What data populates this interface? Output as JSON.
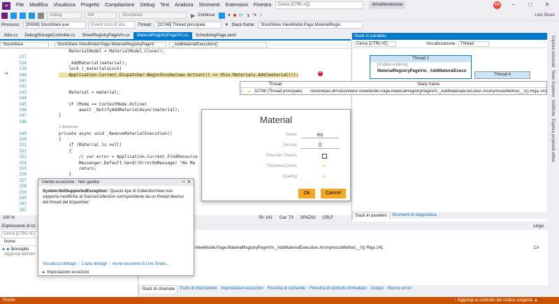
{
  "menu": {
    "items": [
      "File",
      "Modifica",
      "Visualizza",
      "Progetto",
      "Compilazione",
      "Debug",
      "Test",
      "Analizza",
      "Strumenti",
      "Estensioni",
      "Finestra",
      "?"
    ],
    "search_placeholder": "Cerca (CTRL+Q)",
    "app_name": "AlmaWarehouse",
    "avatar": "MN",
    "live_share": "Live Share"
  },
  "toolbar": {
    "config": "Debug",
    "platform": "x64",
    "project": "StockWare",
    "continue": "Continua",
    "processo_label": "Processo:",
    "processo": "[30888] StockWare.exe",
    "eventi": "Eventi ciclo di vita",
    "thread_label": "Thread:",
    "thread": "[32748] Thread principale",
    "stack_label": "Stack frame:",
    "stack": "StockWare.ViewModel.Page.MaterialRegio"
  },
  "tabs": [
    {
      "label": "Jobs.cs"
    },
    {
      "label": "DebugStorageController.cs"
    },
    {
      "label": "SheetRegistryPageVm.cs"
    },
    {
      "label": "MaterialRegistryPageVm.cs",
      "active": true
    },
    {
      "label": "SchedulingPage.xaml"
    }
  ],
  "navbar": {
    "project": "StockWare",
    "class": "StockWare.ViewModel.Page.MaterialRegistryPageV",
    "method": "_AddMaterialExecution()"
  },
  "code": {
    "lines": [
      {
        "n": "",
        "t": "    MaterialNodel = MaterialModel.Clone();"
      },
      {
        "n": "137",
        "t": ""
      },
      {
        "n": "138",
        "t": "    _AddMaterial(material);"
      },
      {
        "n": "139",
        "t": "    lock (_materialsLock)"
      },
      {
        "n": "140",
        "t": "    Application.Current.Dispatcher.BeginInvoke(new Action(() => this.Materials.Add(material)));"
      },
      {
        "n": "141",
        "t": ""
      },
      {
        "n": "142",
        "t": ""
      },
      {
        "n": "143",
        "t": "    Material = material;"
      },
      {
        "n": "144",
        "t": ""
      },
      {
        "n": "145",
        "t": "    if (Mode == ContextMode.Online)"
      },
      {
        "n": "146",
        "t": "        await _NotifyAddMaterialAsync(material);"
      },
      {
        "n": "147",
        "t": "}"
      },
      {
        "n": "148",
        "t": ""
      },
      {
        "n": "",
        "t": "1 riferimento"
      },
      {
        "n": "149",
        "t": "private async void _RemoveMaterialExecution()"
      },
      {
        "n": "150",
        "t": "{"
      },
      {
        "n": "151",
        "t": "    if (Material is null)"
      },
      {
        "n": "152",
        "t": "    {"
      },
      {
        "n": "153",
        "t": "        // var error = Application.Current.FindResource"
      },
      {
        "n": "154",
        "t": "        Messenger.Default.Send((ErrorVmMessage) \"No Ma"
      },
      {
        "n": "155",
        "t": "        return;"
      },
      {
        "n": "156",
        "t": "    }"
      },
      {
        "n": "157",
        "t": ""
      },
      {
        "n": "158",
        "t": ""
      },
      {
        "n": "159",
        "t": ""
      },
      {
        "n": "160",
        "t": ""
      },
      {
        "n": "161",
        "t": ""
      },
      {
        "n": "162",
        "t": ""
      }
    ]
  },
  "editor_status": {
    "zoom": "100 %",
    "line": "Ri: 141",
    "col": "Car: 73",
    "space": "SPAZIO",
    "eol": "CRLF"
  },
  "parallel_stack": {
    "title": "Stack in parallelo",
    "search_placeholder": "Cerca (CTRL+E)",
    "view_label": "Visualizzazione:",
    "view": "Thread",
    "thread1": "Thread 1",
    "ext": "[Codice esterno]",
    "frame": "MaterialRegistryPageVm._AddMaterialExecu",
    "thread4": "Thread 4",
    "tabs": [
      "Stack in parallelo",
      "Strumenti di diagnostica"
    ]
  },
  "tooltip": {
    "col_thread": "Thread",
    "col_frame": "Stack frame",
    "thread": "32748 (Thread principale)",
    "frame": "StockWare.dll!StockWare.ViewModel.Page.MaterialRegistryPageVm._AddMaterialExecution.AnonymousMethod__0() Riga 141"
  },
  "dialog": {
    "title": "Material",
    "fields": [
      {
        "label": "Name",
        "value": "es",
        "kind": "text"
      },
      {
        "label": "Density",
        "value": "0",
        "kind": "text"
      },
      {
        "label": "Override Checks",
        "kind": "check"
      },
      {
        "label": "ThicknessCheck",
        "kind": "lines"
      },
      {
        "label": "Spalling",
        "kind": "lines"
      }
    ],
    "ok": "Ok",
    "cancel": "Cancel",
    "accent": "#f5a623"
  },
  "exception": {
    "header": "Utente eccezione - Non gestita",
    "type": "System.NotSupportedException:",
    "message": " 'Questo tipo di CollectionView non supporta modifiche al SourceCollection corrispondente da un thread diverso dal thread del dispatcher.'",
    "links": [
      "Visualizza dettagli",
      "Copia dettagli",
      "Avvia sessione di Live Share..."
    ],
    "settings": "Impostazioni eccezioni"
  },
  "bottom_left": {
    "title": "Espressione di co",
    "search": "Cerca (CTRL+E)",
    "col": "Nome",
    "row": "$exceptio",
    "add": "Aggiungi elemen"
  },
  "bottom_right": {
    "lang_header": "Lingu",
    "row": "ViewModel.Page.MaterialRegistryPageVm._AddMaterialExecution.AnonymousMethod__0() Riga 141",
    "lang": "C#",
    "tabs": [
      "Stack di chiamate",
      "Punti di interruzione",
      "Impostazioni eccezioni",
      "Finestra di comando",
      "Finestra di controllo immediato",
      "Output",
      "Elenco errori"
    ]
  },
  "side": [
    "Esplora soluzioni",
    "Team Explorer",
    "Notifiche",
    "Esplora proprietà attive"
  ],
  "status": {
    "left": "Pronto",
    "right": "Aggiungi al controllo del codice sorgente"
  }
}
